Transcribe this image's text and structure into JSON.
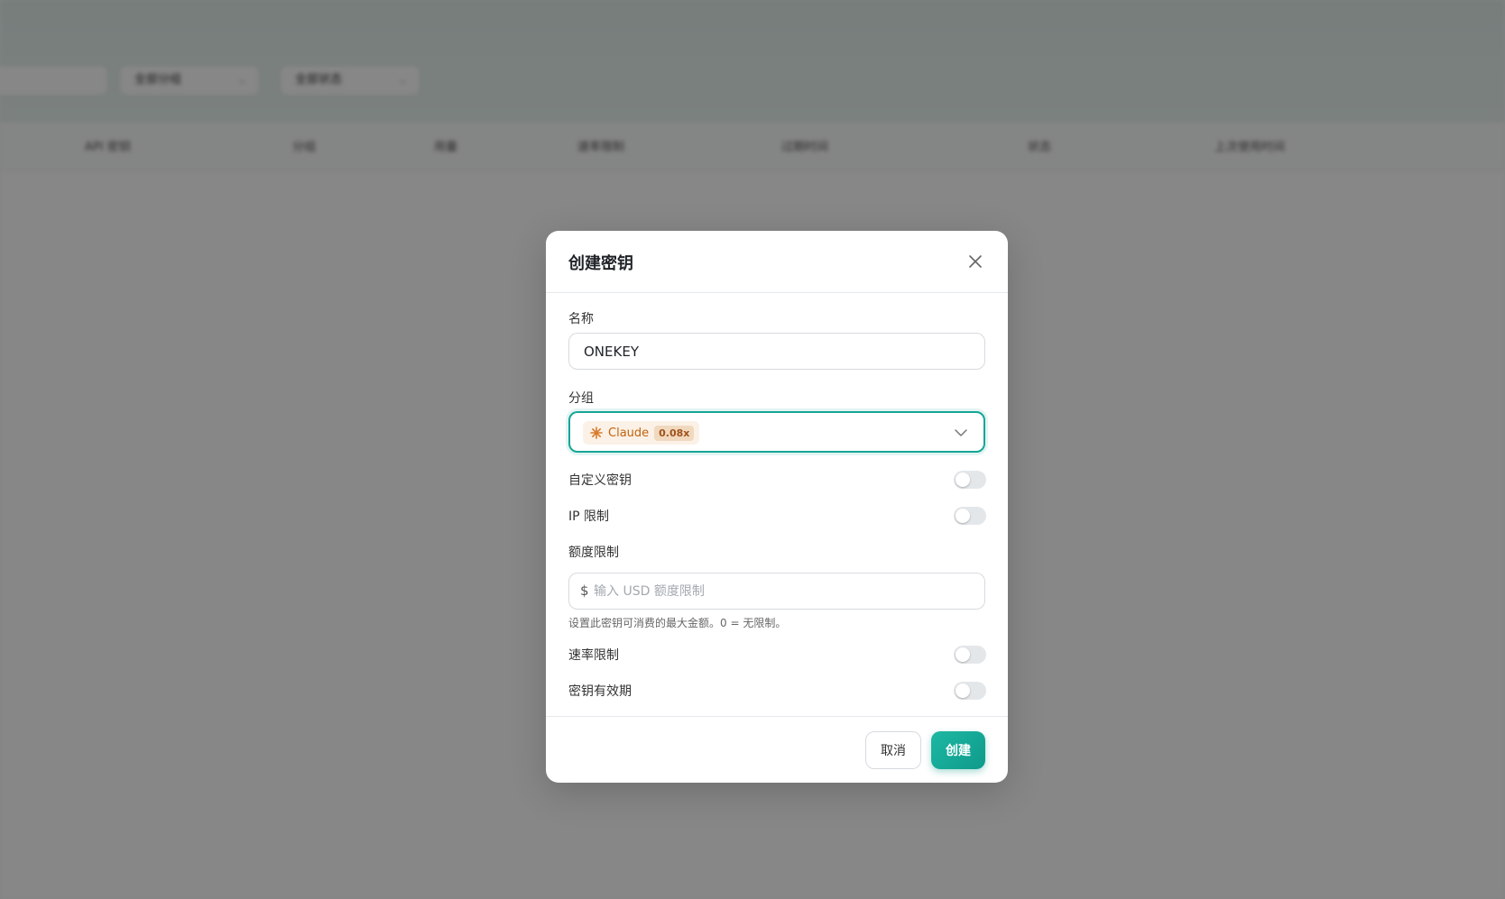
{
  "background": {
    "filters": [
      {
        "label": "全部分组"
      },
      {
        "label": "全部状态"
      }
    ],
    "table_headers": [
      "API 密钥",
      "分组",
      "用量",
      "速率限制",
      "过期时间",
      "状态",
      "上次使用时间"
    ]
  },
  "modal": {
    "title": "创建密钥",
    "name_label": "名称",
    "name_value": "ONEKEY",
    "group_label": "分组",
    "group_selected": {
      "name": "Claude",
      "rate": "0.08x"
    },
    "custom_key_label": "自定义密钥",
    "ip_limit_label": "IP 限制",
    "quota_label": "额度限制",
    "quota_currency": "$",
    "quota_placeholder": "输入 USD 额度限制",
    "quota_hint": "设置此密钥可消费的最大金额。0 = 无限制。",
    "rate_limit_label": "速率限制",
    "expiry_label": "密钥有效期",
    "toggles": {
      "custom_key": false,
      "ip_limit": false,
      "rate_limit": false,
      "expiry": false
    },
    "cancel_label": "取消",
    "create_label": "创建"
  },
  "colors": {
    "accent": "#15a596",
    "chip_bg": "#fbf1e6",
    "chip_text": "#c2620f"
  },
  "icons": {
    "close": "close-icon",
    "chevron": "chevron-down-icon",
    "claude": "claude-sunburst-icon"
  }
}
